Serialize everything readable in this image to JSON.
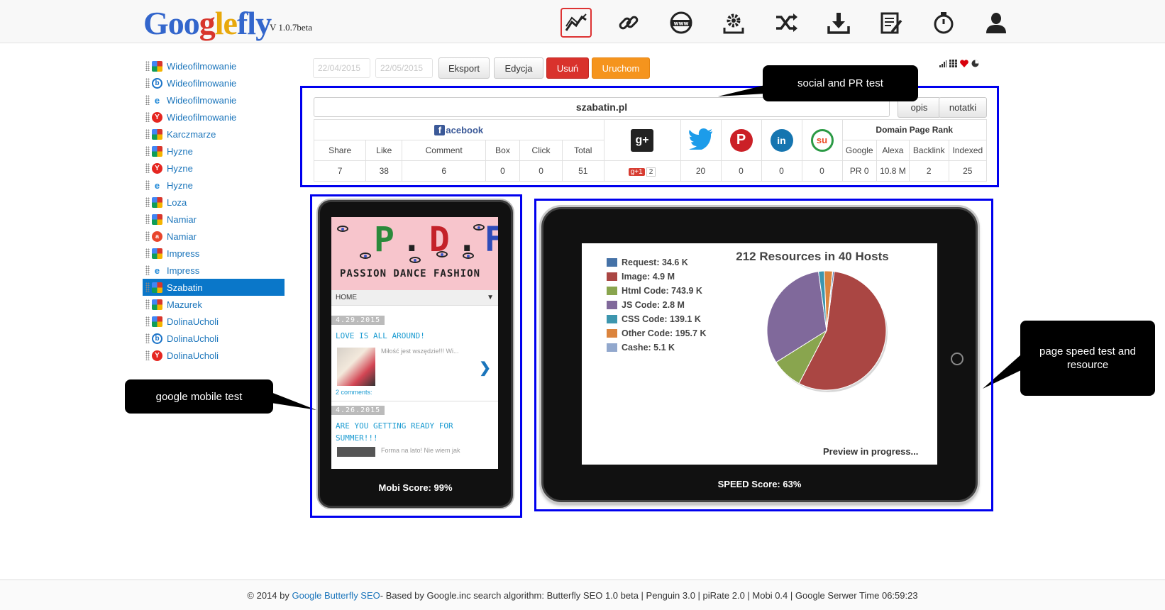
{
  "header": {
    "logo_parts": [
      "Goo",
      "g",
      "le",
      "fly"
    ],
    "version": "V 1.0.7beta",
    "nav_icons": [
      "chart-line-icon",
      "link-icon",
      "www-globe-icon",
      "gear-icon",
      "shuffle-icon",
      "download-icon",
      "edit-document-icon",
      "stopwatch-icon",
      "user-icon"
    ],
    "active_nav": "chart-line-icon"
  },
  "sidebar": {
    "items": [
      {
        "engine": "google",
        "label": "Wideofilmowanie"
      },
      {
        "engine": "bing",
        "label": "Wideofilmowanie"
      },
      {
        "engine": "ie",
        "label": "Wideofilmowanie"
      },
      {
        "engine": "yandex",
        "label": "Wideofilmowanie"
      },
      {
        "engine": "google",
        "label": "Karczmarze"
      },
      {
        "engine": "google",
        "label": "Hyzne"
      },
      {
        "engine": "yandex",
        "label": "Hyzne"
      },
      {
        "engine": "ie",
        "label": "Hyzne"
      },
      {
        "engine": "google",
        "label": "Loza"
      },
      {
        "engine": "google",
        "label": "Namiar"
      },
      {
        "engine": "ask",
        "label": "Namiar"
      },
      {
        "engine": "google",
        "label": "Impress"
      },
      {
        "engine": "ie",
        "label": "Impress"
      },
      {
        "engine": "google",
        "label": "Szabatin"
      },
      {
        "engine": "google",
        "label": "Mazurek"
      },
      {
        "engine": "google",
        "label": "DolinaUcholi"
      },
      {
        "engine": "bing",
        "label": "DolinaUcholi"
      },
      {
        "engine": "yandex",
        "label": "DolinaUcholi"
      }
    ],
    "active_label": "Szabatin"
  },
  "toolbar": {
    "date_from": "22/04/2015",
    "date_to": "22/05/2015",
    "export_label": "Eksport",
    "edit_label": "Edycja",
    "delete_label": "Usuń",
    "run_label": "Uruchom"
  },
  "social": {
    "domain": "szabatin.pl",
    "opis_label": "opis",
    "notatki_label": "notatki",
    "facebook_label": "acebook",
    "facebook_f": "f",
    "fb_columns": [
      "Share",
      "Like",
      "Comment",
      "Box",
      "Click",
      "Total"
    ],
    "fb_values": [
      "7",
      "38",
      "6",
      "0",
      "0",
      "51"
    ],
    "gplus_badge": "g+1",
    "gplus_count": "2",
    "twitter": "20",
    "pinterest": "0",
    "linkedin": "0",
    "stumbleupon": "0",
    "rank_title": "Domain Page Rank",
    "rank_columns": [
      "Google",
      "Alexa",
      "Backlink",
      "Indexed"
    ],
    "rank_values": [
      "PR 0",
      "10.8 M",
      "2",
      "25"
    ]
  },
  "callouts": {
    "social": "social and PR test",
    "mobile": "google mobile test",
    "speed": "page speed test and resource"
  },
  "mobile": {
    "banner_letters": [
      "P",
      ".",
      "D",
      ".",
      "F"
    ],
    "banner_sub": "PASSION DANCE FASHION",
    "menu_label": "HOME",
    "menu_caret": "▼",
    "post1_date": "4.29.2015",
    "post1_title": "LOVE IS ALL AROUND!",
    "post1_text": "Miłość jest wszędzie!!! Wi...",
    "post1_comments": "2 comments:",
    "post2_date": "4.26.2015",
    "post2_title": "ARE YOU GETTING READY FOR SUMMER!!!",
    "post2_text": "Forma na lato! Nie wiem jak",
    "score": "Mobi Score: 99%"
  },
  "speed": {
    "score": "SPEED Score: 63%",
    "preview": "Preview in progress..."
  },
  "chart_data": {
    "type": "pie",
    "title": "212 Resources in 40 Hosts",
    "categories": [
      "Request",
      "Image",
      "Html Code",
      "JS Code",
      "CSS Code",
      "Other Code",
      "Cashe"
    ],
    "values": [
      34.6,
      4900,
      743.9,
      2800,
      139.1,
      195.7,
      5.1
    ],
    "legend_labels": [
      "Request: 34.6 K",
      "Image: 4.9 M",
      "Html Code: 743.9 K",
      "JS Code: 2.8 M",
      "CSS Code: 139.1 K",
      "Other Code: 195.7 K",
      "Cashe: 5.1 K"
    ],
    "colors": [
      "#4572a7",
      "#aa4643",
      "#89a54e",
      "#80699b",
      "#3d96ae",
      "#db843d",
      "#92a8cd"
    ],
    "legend": "left"
  },
  "footer": {
    "prefix": "© 2014 by ",
    "link": "Google Butterfly SEO",
    "rest": " - Based by Google.inc search algorithm: Butterfly SEO 1.0 beta | Penguin 3.0 | piRate 2.0 | Mobi 0.4 | Google Serwer Time 06:59:23"
  }
}
